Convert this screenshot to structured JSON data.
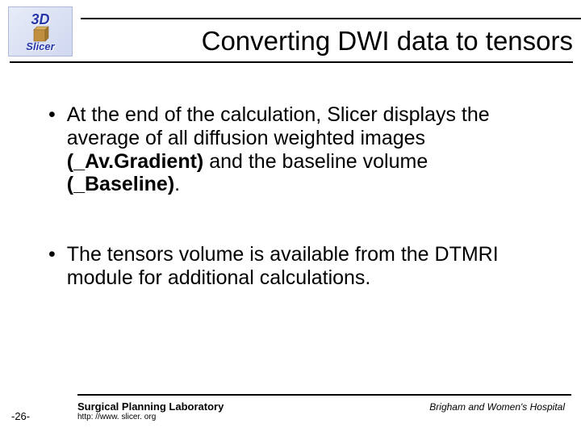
{
  "logo": {
    "top": "3D",
    "bottom": "Slicer"
  },
  "title": "Converting DWI data to tensors",
  "bullets": [
    {
      "pre": "At the end of the calculation, Slicer displays the average of all diffusion weighted images ",
      "bold1": "(_Av.Gradient)",
      "mid": " and the baseline volume ",
      "bold2": "(_Baseline)",
      "post": "."
    },
    {
      "pre": "The tensors volume is available from the DTMRI module for additional calculations.",
      "bold1": "",
      "mid": "",
      "bold2": "",
      "post": ""
    }
  ],
  "footer": {
    "page": "-26-",
    "lab": "Surgical Planning Laboratory",
    "url": "http: //www. slicer. org",
    "hospital": "Brigham and Women's Hospital"
  }
}
